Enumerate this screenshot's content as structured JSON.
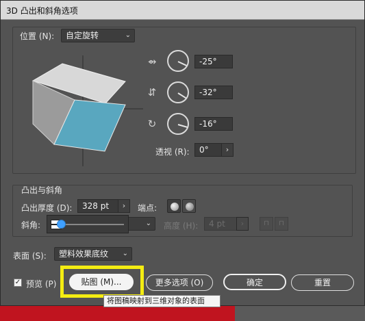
{
  "window": {
    "title": "3D 凸出和斜角选项"
  },
  "position": {
    "label": "位置 (N):",
    "preset": "自定旋转"
  },
  "rotation": {
    "x_value": "-25°",
    "y_value": "-32°",
    "z_value": "-16°"
  },
  "perspective": {
    "label": "透视 (R):",
    "value": "0°"
  },
  "extrude_bevel": {
    "heading": "凸出与斜角",
    "depth_label": "凸出厚度 (D):",
    "depth_value": "328 pt",
    "cap_label": "端点:",
    "bevel_label": "斜角:",
    "height_label": "高度 (H):",
    "height_value": "4 pt"
  },
  "surface": {
    "label": "表面 (S):",
    "value": "塑料效果底纹"
  },
  "footer": {
    "preview_label": "预览 (P)",
    "preview_checked": true,
    "map_label": "贴图 (M)...",
    "more_label": "更多选项 (O)",
    "ok_label": "确定",
    "reset_label": "重置"
  },
  "tooltip": {
    "text": "将图稿映射到三维对象的表面"
  },
  "colors": {
    "cube_front": "#59a7bf",
    "cube_top": "#d8d8d8",
    "cube_side": "#9b9b9b",
    "highlight": "#f4ec12",
    "dialog_bg": "#535353"
  }
}
